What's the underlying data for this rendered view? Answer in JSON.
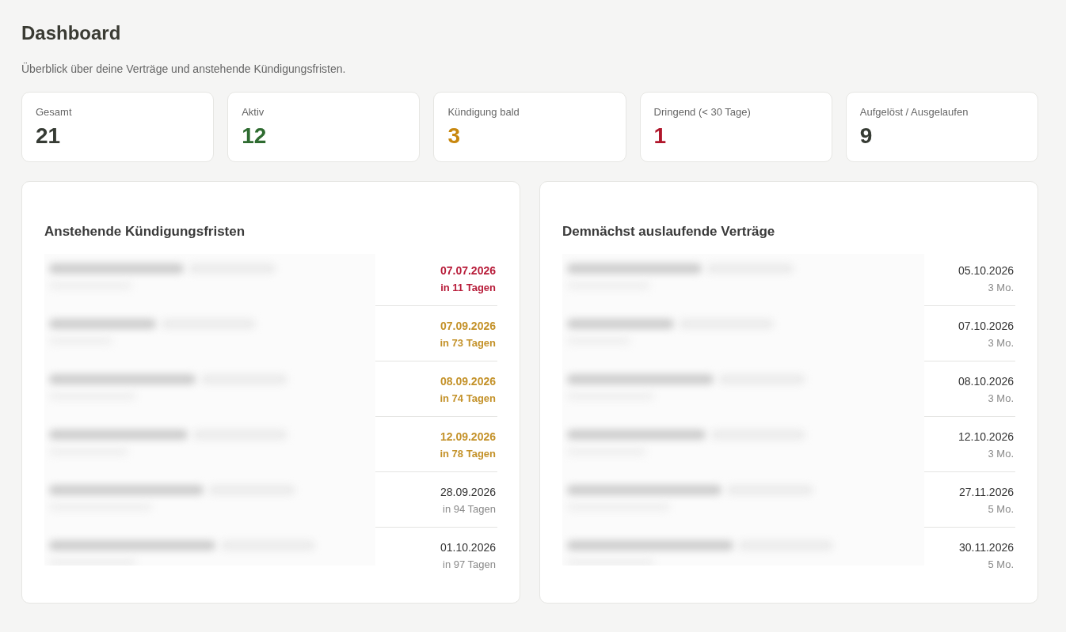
{
  "page": {
    "title": "Dashboard",
    "subtitle": "Überblick über deine Verträge und anstehende Kündigungsfristen."
  },
  "stats": [
    {
      "label": "Gesamt",
      "value": "21",
      "color": "#363b34"
    },
    {
      "label": "Aktiv",
      "value": "12",
      "color": "#2e6b30"
    },
    {
      "label": "Kündigung bald",
      "value": "3",
      "color": "#c8870e"
    },
    {
      "label": "Dringend (< 30 Tage)",
      "value": "1",
      "color": "#b0162b"
    },
    {
      "label": "Aufgelöst / Ausgelaufen",
      "value": "9",
      "color": "#363b34"
    }
  ],
  "panels": [
    {
      "kind": "deadlines",
      "title": "Anstehende Kündigungsfristen",
      "rows": [
        {
          "date": "07.07.2026",
          "note": "in 11 Tagen",
          "color": "#b81d3a"
        },
        {
          "date": "07.09.2026",
          "note": "in 73 Tagen",
          "color": "#c4922a"
        },
        {
          "date": "08.09.2026",
          "note": "in 74 Tagen",
          "color": "#c4922a"
        },
        {
          "date": "12.09.2026",
          "note": "in 78 Tagen",
          "color": "#c4922a"
        },
        {
          "date": "28.09.2026",
          "note": "in 94 Tagen"
        },
        {
          "date": "01.10.2026",
          "note": "in 97 Tagen"
        }
      ]
    },
    {
      "kind": "expiring",
      "title": "Demnächst auslaufende Verträge",
      "rows": [
        {
          "date": "05.10.2026",
          "note": "3 Mo."
        },
        {
          "date": "07.10.2026",
          "note": "3 Mo."
        },
        {
          "date": "08.10.2026",
          "note": "3 Mo."
        },
        {
          "date": "12.10.2026",
          "note": "3 Mo."
        },
        {
          "date": "27.11.2026",
          "note": "5 Mo."
        },
        {
          "date": "30.11.2026",
          "note": "5 Mo."
        }
      ]
    }
  ]
}
